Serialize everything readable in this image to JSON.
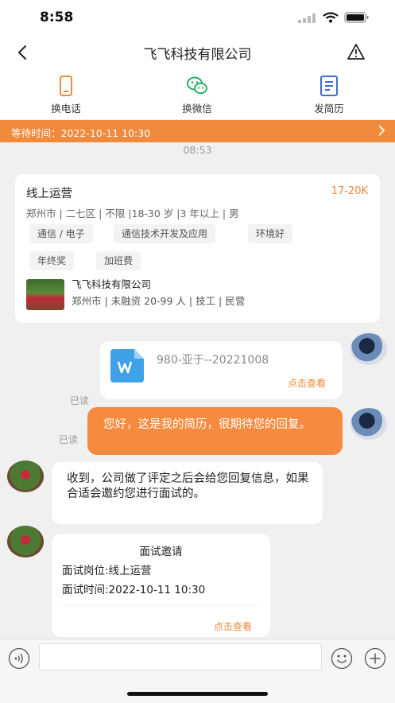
{
  "status_bar": {
    "time": "8:58"
  },
  "header": {
    "title": "飞飞科技有限公司"
  },
  "actions": [
    {
      "label": "换电话",
      "icon": "phone-icon"
    },
    {
      "label": "换微信",
      "icon": "wechat-icon"
    },
    {
      "label": "发简历",
      "icon": "resume-icon"
    }
  ],
  "wait_bar": {
    "text": "等待时间：2022-10-11 10:30"
  },
  "timestamp": "08:53",
  "job_card": {
    "title": "线上运营",
    "salary": "17-20K",
    "requirements": "郑州市 | 二七区 | 不限 |18-30 岁 |3 年以上 | 男",
    "tags": [
      "通信 / 电子",
      "通信技术开发及应用",
      "环境好",
      "年终奖",
      "加班费"
    ],
    "company_name": "飞飞科技有限公司",
    "company_info": "郑州市 | 未融资 20-99 人 | 技工 | 民营"
  },
  "messages": {
    "resume_file": {
      "name": "980-亚于--20221008",
      "link": "点击查看",
      "read": "已读"
    },
    "my_text": {
      "text": "您好，这是我的简历，很期待您的回复。",
      "read": "已读"
    },
    "company_reply": {
      "text": "收到，公司做了评定之后会给您回复信息，如果合适会邀约您进行面试的。"
    },
    "interview": {
      "title": "面试邀请",
      "position": "面试岗位:线上运营",
      "time": "面试时间:2022-10-11 10:30",
      "link": "点击查看"
    }
  },
  "colors": {
    "accent": "#f08a3c",
    "wechat": "#2aae67",
    "resume": "#3d6fd0"
  }
}
